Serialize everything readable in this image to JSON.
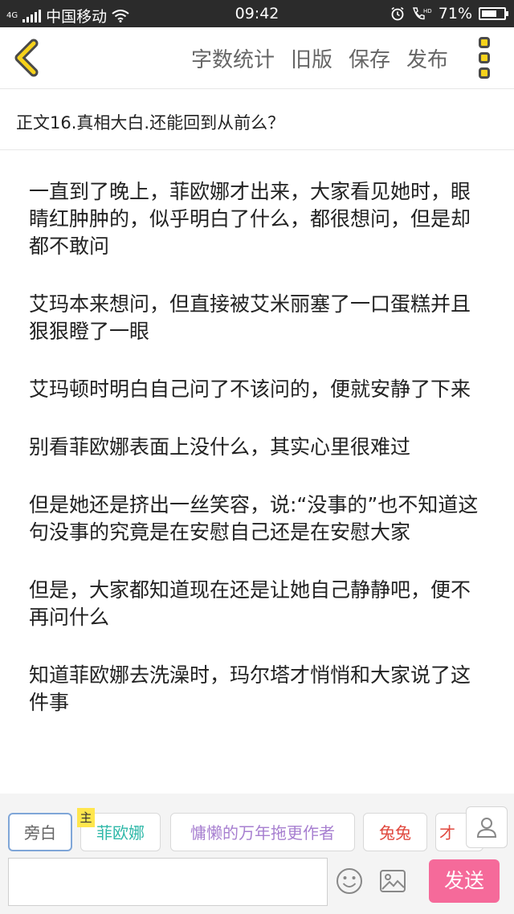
{
  "status_bar": {
    "network_label": "4G",
    "carrier": "中国移动",
    "time": "09:42",
    "battery_text": "71%",
    "battery_level": 0.71
  },
  "toolbar": {
    "word_count": "字数统计",
    "old_version": "旧版",
    "save": "保存",
    "publish": "发布"
  },
  "chapter": {
    "title": "正文16.真相大白.还能回到从前么？"
  },
  "paragraphs": [
    "一直到了晚上，菲欧娜才出来，大家看见她时，眼睛红肿肿的，似乎明白了什么，都很想问，但是却都不敢问",
    "艾玛本来想问，但直接被艾米丽塞了一口蛋糕并且狠狠瞪了一眼",
    "艾玛顿时明白自己问了不该问的，便就安静了下来",
    "别看菲欧娜表面上没什么，其实心里很难过",
    "但是她还是挤出一丝笑容，说:“没事的”也不知道这句没事的究竟是在安慰自己还是在安慰大家",
    "但是，大家都知道现在还是让她自己静静吧，便不再问什么",
    "知道菲欧娜去洗澡时，玛尔塔才悄悄和大家说了这件事"
  ],
  "speakers": {
    "host_tag": "主",
    "items": [
      {
        "label": "旁白",
        "color": "#666666"
      },
      {
        "label": "菲欧娜",
        "color": "#2fb8a8"
      },
      {
        "label": "慵懒的万年拖更作者",
        "color": "#a77fd0"
      },
      {
        "label": "兔兔",
        "color": "#e0483e"
      },
      {
        "label": "才",
        "color": "#e0483e"
      }
    ]
  },
  "input": {
    "value": "",
    "send_label": "发送"
  },
  "icons": {
    "back": "chevron-left-icon",
    "more": "more-vertical-icon",
    "add_character": "person-icon",
    "emoji": "emoji-icon",
    "image": "image-icon"
  },
  "colors": {
    "accent_yellow": "#f6d21b",
    "send_pink": "#f56a9a",
    "status_bar": "#2b2b2b"
  }
}
